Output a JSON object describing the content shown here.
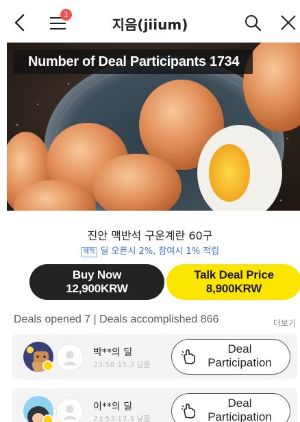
{
  "header": {
    "title": "지음(jiium)",
    "menu_badge": "1"
  },
  "hero": {
    "participants_label": "Number of Deal Participants 1734"
  },
  "product": {
    "name": "진안 맥반석 구운계란 60구",
    "benefit_tag": "혜택",
    "benefit_text": "딜 오픈시 2%, 참여시 1% 적립"
  },
  "actions": {
    "buy_now_label": "Buy Now",
    "buy_now_price": "12,900KRW",
    "talk_deal_label": "Talk Deal Price",
    "talk_deal_price": "8,900KRW"
  },
  "stats": {
    "text": "Deals opened 7 | Deals accomplished  866",
    "more_label": "더보기"
  },
  "deals": [
    {
      "name": "박**의 딜",
      "timer": "23:58:15.3 남음",
      "join_line1": "Deal",
      "join_line2": "Participation"
    },
    {
      "name": "이**의 딜",
      "timer": "23:53:17.3 남음",
      "join_line1": "Deal",
      "join_line2": "Participation"
    }
  ],
  "colors": {
    "talk_yellow": "#fce600",
    "buy_dark": "#232323",
    "badge_red": "#f0524a",
    "benefit_blue": "#3d6fd8"
  }
}
